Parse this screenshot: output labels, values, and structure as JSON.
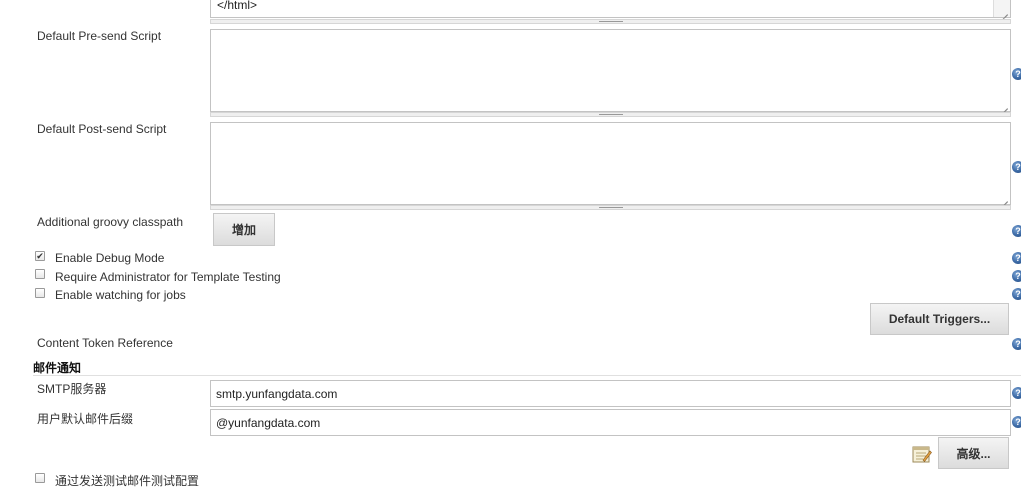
{
  "html_content": {
    "tail_text": "</html>"
  },
  "pre_send": {
    "label": "Default Pre-send Script",
    "value": ""
  },
  "post_send": {
    "label": "Default Post-send Script",
    "value": ""
  },
  "classpath": {
    "label": "Additional groovy classpath",
    "add_button": "增加"
  },
  "options": {
    "debug_label": "Enable Debug Mode",
    "debug_checked": true,
    "admin_label": "Require Administrator for Template Testing",
    "admin_checked": false,
    "watch_label": "Enable watching for jobs",
    "watch_checked": false
  },
  "triggers": {
    "button_label": "Default Triggers..."
  },
  "token_ref": {
    "label": "Content Token Reference"
  },
  "mail_section": {
    "title": "邮件通知",
    "smtp_label": "SMTP服务器",
    "smtp_value": "smtp.yunfangdata.com",
    "suffix_label": "用户默认邮件后缀",
    "suffix_value": "@yunfangdata.com",
    "advanced_button": "高级...",
    "test_label": "通过发送测试邮件测试配置",
    "test_checked": false
  },
  "icons": {
    "help": "help-icon",
    "notepad": "notepad-icon",
    "help_glyph": "?"
  },
  "colors": {
    "help_blue": "#3c6aa6",
    "border": "#c3c3c3",
    "button_bg": "#e4e4e4"
  }
}
